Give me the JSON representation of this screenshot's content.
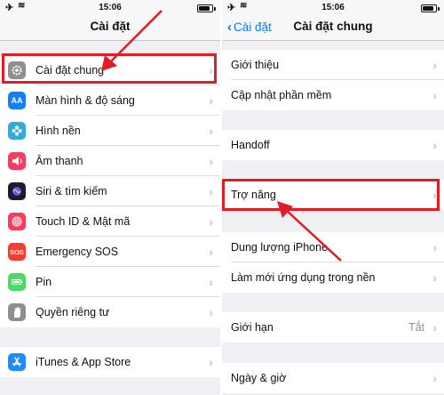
{
  "status": {
    "time": "15:06"
  },
  "left": {
    "title": "Cài đặt",
    "items": [
      {
        "label": "Cài đặt chung",
        "icon": "gear-icon",
        "color": "#8e8e93"
      },
      {
        "label": "Màn hình & độ sáng",
        "icon": "display-brightness-icon",
        "color": "#147efb"
      },
      {
        "label": "Hình nền",
        "icon": "wallpaper-icon",
        "color": "#35aadc"
      },
      {
        "label": "Âm thanh",
        "icon": "sound-icon",
        "color": "#fe3b5f"
      },
      {
        "label": "Siri & tìm kiếm",
        "icon": "siri-icon",
        "color": "#1c1c2e"
      },
      {
        "label": "Touch ID & Mật mã",
        "icon": "fingerprint-icon",
        "color": "#fe3b5f"
      },
      {
        "label": "Emergency SOS",
        "icon": "sos-icon",
        "color": "#fe3b30"
      },
      {
        "label": "Pin",
        "icon": "battery-icon",
        "color": "#4cd964"
      },
      {
        "label": "Quyền riêng tư",
        "icon": "privacy-hand-icon",
        "color": "#8e8e93"
      },
      {
        "label": "iTunes & App Store",
        "icon": "app-store-icon",
        "color": "#1e8cff"
      }
    ],
    "sos_text": "SOS",
    "aa_text": "AA"
  },
  "right": {
    "back_label": "Cài đặt",
    "title": "Cài đặt chung",
    "items": [
      {
        "label": "Giới thiệu"
      },
      {
        "label": "Cập nhật phần mềm"
      },
      {
        "label": "Handoff"
      },
      {
        "label": "Trợ năng"
      },
      {
        "label": "Dung lượng iPhone"
      },
      {
        "label": "Làm mới ứng dụng trong nền"
      },
      {
        "label": "Giới hạn",
        "value": "Tắt"
      },
      {
        "label": "Ngày & giờ"
      }
    ]
  },
  "colors": {
    "highlight": "#e01c24",
    "accent": "#0a7aff"
  }
}
